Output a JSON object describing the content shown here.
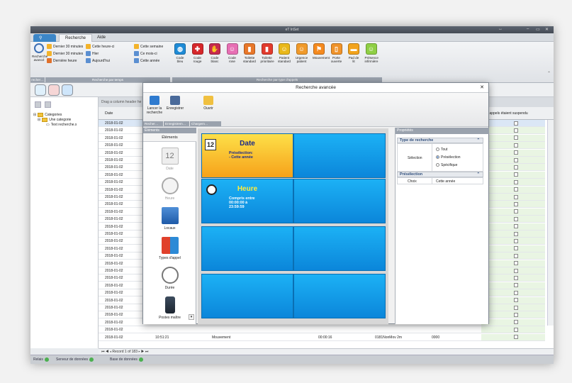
{
  "window": {
    "title": "eT InSet",
    "controls": [
      "↔",
      "–",
      "▭",
      "✕"
    ]
  },
  "ribbon": {
    "tabs": [
      "Recherche",
      "Aide"
    ],
    "time_group": {
      "big_label": "Recherche avancé",
      "small_label": "recher…",
      "items": [
        "Dernier 30 minutes",
        "Dernier 30 minutes",
        "Dernière heure",
        "Cette heure-ci",
        "Hier",
        "Aujourd'hui",
        "Cette semaine",
        "Ce mois-ci",
        "Cette année"
      ],
      "group_label": "Recherche par temps"
    },
    "call_types": {
      "items": [
        {
          "label": "Code bleu",
          "color": "#1f8bd6",
          "glyph": "◍"
        },
        {
          "label": "Code rouge",
          "color": "#d6272b",
          "glyph": "✚"
        },
        {
          "label": "Code blanc",
          "color": "#c62a4f",
          "glyph": "✋"
        },
        {
          "label": "Code rose",
          "color": "#e76fb4",
          "glyph": "☺"
        },
        {
          "label": "Toilette standard",
          "color": "#e8772a",
          "glyph": "▮"
        },
        {
          "label": "Toilette prioritaire",
          "color": "#e23a2d",
          "glyph": "▮"
        },
        {
          "label": "Patient standard",
          "color": "#e9b81a",
          "glyph": "☺"
        },
        {
          "label": "Urgence patient",
          "color": "#f09a2b",
          "glyph": "☺"
        },
        {
          "label": "Mouvement",
          "color": "#f58a1f",
          "glyph": "⚑"
        },
        {
          "label": "Porte ouverte",
          "color": "#f0932a",
          "glyph": "▯"
        },
        {
          "label": "Pad de lit",
          "color": "#f2a31c",
          "glyph": "▬"
        },
        {
          "label": "Présence infirmière",
          "color": "#8fcf45",
          "glyph": "☺"
        }
      ],
      "group_label": "Recherche par type d'appels"
    }
  },
  "leftpane": {
    "tree": [
      "Categories",
      "Une categorie",
      "Text recherche.x"
    ]
  },
  "grid": {
    "group_hint": "Drag a column header he",
    "col_date": "Date",
    "col_suspended": "Les appels étaient suspendu",
    "rows_date": "2018-01-02",
    "last_rows": [
      {
        "date": "2018-01-02",
        "time": "10:51:21",
        "type": "Mouvement",
        "dur": "00:00:16",
        "loc": "0181NonMov 2m",
        "code": "0000"
      }
    ],
    "nav": "Record 1 of 183"
  },
  "status": {
    "items": [
      "Relais",
      "Serveur de données",
      "Base de données"
    ]
  },
  "dialog": {
    "title": "Recherche avancée",
    "close": "✕",
    "toolbar": {
      "launch": "Lancer la recherche",
      "save": "Enregistrer",
      "open": "Ouvrir"
    },
    "toolbar_groups": [
      "Recher…",
      "Enregistrem…",
      "Chargem…"
    ],
    "elements_header": "Éléments",
    "elements_sub": "Éléments",
    "elements": [
      "Date",
      "Heure",
      "Locaux",
      "Types d'appel",
      "Durée",
      "Postes maître"
    ],
    "tile_date": {
      "title": "Date",
      "line1": "Présélection:",
      "line2": "- Cette année"
    },
    "tile_heure": {
      "title": "Heure",
      "line1": "Compris entre",
      "line2": "00:00:00 à",
      "line3": "23:59:59"
    },
    "props": {
      "header": "Propriétés",
      "sec1": "Type de recherche",
      "selection_label": "Sélection",
      "options": [
        "Tout",
        "Présélection",
        "Spécifique"
      ],
      "selected": "Présélection",
      "sec2": "Présélection",
      "choix_label": "Choix",
      "choix_value": "Cette année"
    }
  }
}
